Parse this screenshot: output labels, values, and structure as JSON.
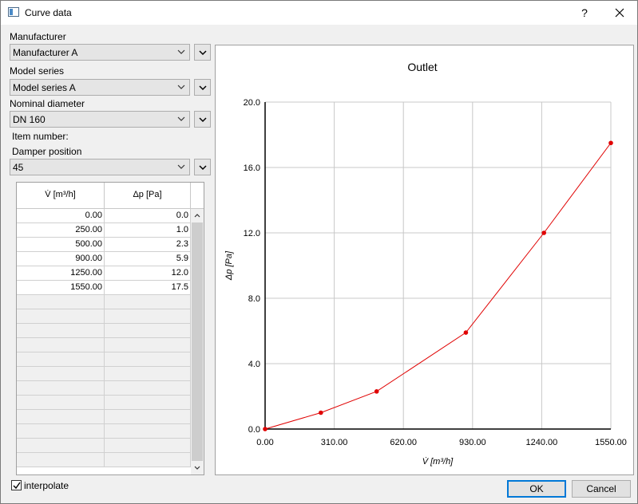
{
  "window": {
    "title": "Curve data",
    "help": "?"
  },
  "form": {
    "manufacturer_label": "Manufacturer",
    "manufacturer_value": "Manufacturer A",
    "series_label": "Model series",
    "series_value": "Model series A",
    "diameter_label": "Nominal diameter",
    "diameter_value": "DN 160",
    "item_label": "Item number:",
    "damper_label": "Damper position",
    "damper_value": "45"
  },
  "table": {
    "headers": [
      "V̇ [m³/h]",
      "Δp [Pa]"
    ],
    "rows": [
      [
        "0.00",
        "0.0"
      ],
      [
        "250.00",
        "1.0"
      ],
      [
        "500.00",
        "2.3"
      ],
      [
        "900.00",
        "5.9"
      ],
      [
        "1250.00",
        "12.0"
      ],
      [
        "1550.00",
        "17.5"
      ]
    ],
    "empty_rows": 12
  },
  "chart_data": {
    "type": "line",
    "title": "Outlet",
    "xlabel": "V̇ [m³/h]",
    "ylabel": "Δp [Pa]",
    "x": [
      0,
      250,
      500,
      900,
      1250,
      1550
    ],
    "y": [
      0.0,
      1.0,
      2.3,
      5.9,
      12.0,
      17.5
    ],
    "xlim": [
      0,
      1550
    ],
    "ylim": [
      0,
      20
    ],
    "xticks": [
      "0.00",
      "310.00",
      "620.00",
      "930.00",
      "1240.00",
      "1550.00"
    ],
    "yticks": [
      "0.0",
      "4.0",
      "8.0",
      "12.0",
      "16.0",
      "20.0"
    ],
    "grid": true,
    "color": "#e00000"
  },
  "footer": {
    "interpolate_label": "interpolate",
    "interpolate_checked": true,
    "ok_label": "OK",
    "cancel_label": "Cancel"
  }
}
